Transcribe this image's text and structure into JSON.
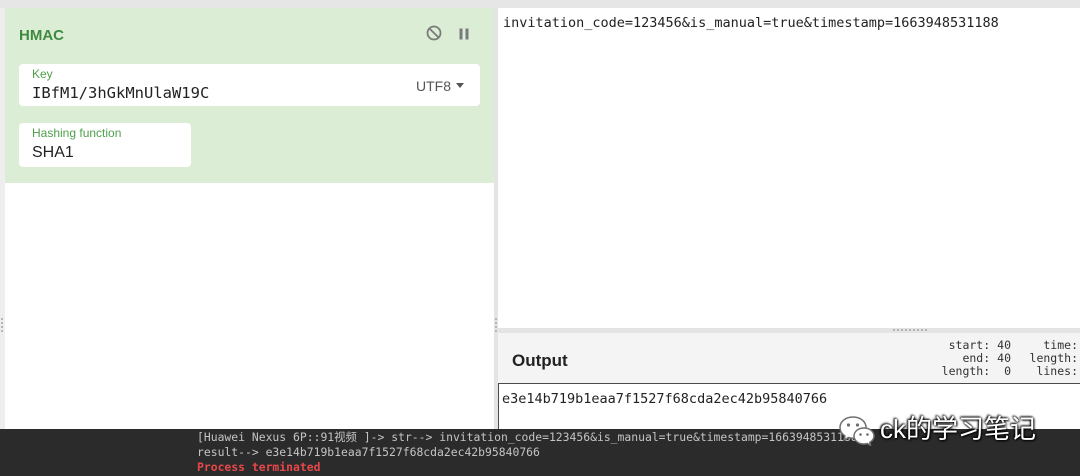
{
  "colors": {
    "operation_bg": "#dcedd5",
    "title_green": "#3f8a3f",
    "label_green": "#4fa04b",
    "terminal_bg": "#2b2b2b",
    "terminal_text": "#c4c4c4",
    "terminal_error": "#e8474a"
  },
  "icons": {
    "disable": "disable-icon",
    "pause": "pause-icon",
    "dropdown": "caret-down-icon",
    "watermark": "wechat-icon"
  },
  "operation": {
    "title": "HMAC",
    "key": {
      "label": "Key",
      "value": "IBfM1/3hGkMnUlaW19C",
      "encoding": "UTF8"
    },
    "hash_function": {
      "label": "Hashing function",
      "value": "SHA1"
    }
  },
  "input": {
    "text": "invitation_code=123456&is_manual=true&timestamp=1663948531188"
  },
  "output": {
    "title": "Output",
    "stats": [
      {
        "label": "start:",
        "value": "40"
      },
      {
        "label": "end:",
        "value": "40"
      },
      {
        "label": "length:",
        "value": "0"
      }
    ],
    "stats_secondary": [
      "time:",
      "length:",
      "lines:"
    ],
    "text": "e3e14b719b1eaa7f1527f68cda2ec42b95840766"
  },
  "terminal": {
    "lines": [
      "[Huawei Nexus 6P::91视频 ]-> str--> invitation_code=123456&is_manual=true&timestamp=1663948531188",
      "result--> e3e14b719b1eaa7f1527f68cda2ec42b95840766"
    ],
    "status": "Process terminated"
  },
  "watermark": {
    "text": "ck的学习笔记"
  }
}
